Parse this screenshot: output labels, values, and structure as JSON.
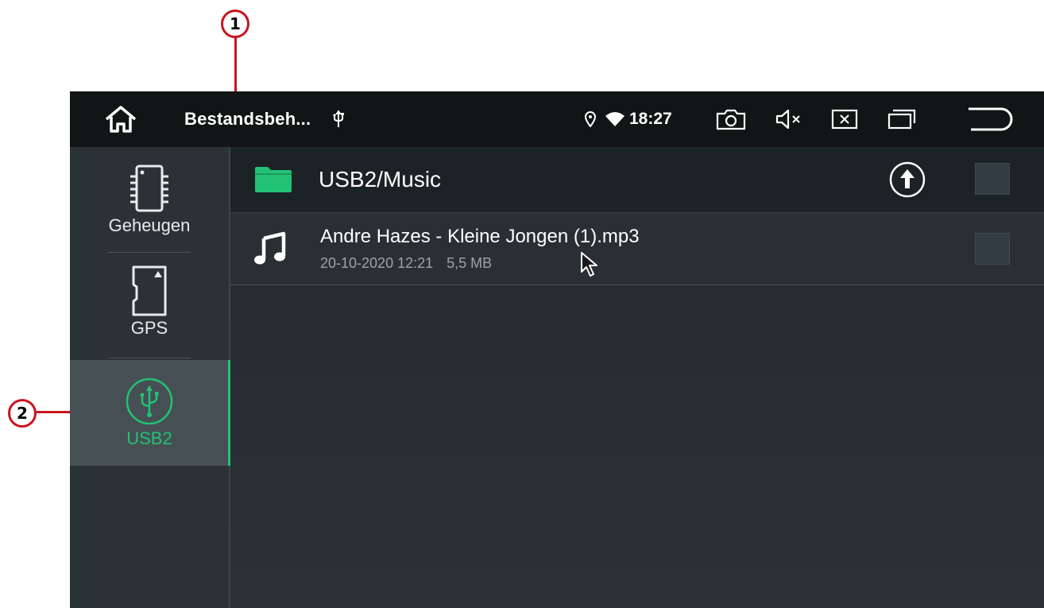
{
  "annotations": {
    "callout1": "1",
    "callout2": "2"
  },
  "statusbar": {
    "title": "Bestandsbeh...",
    "time": "18:27",
    "icons": [
      "home-icon",
      "usb-icon",
      "location-icon",
      "wifi-icon",
      "screenshot-icon",
      "mute-icon",
      "close-app-icon",
      "multitask-icon",
      "back-icon"
    ]
  },
  "sidebar": {
    "items": [
      {
        "label": "Geheugen",
        "icon": "memory-chip-icon",
        "active": false
      },
      {
        "label": "GPS",
        "icon": "sd-card-icon",
        "active": false
      },
      {
        "label": "USB2",
        "icon": "usb-icon",
        "active": true
      }
    ]
  },
  "main": {
    "path": "USB2/Music",
    "files": [
      {
        "name": "Andre Hazes - Kleine Jongen (1).mp3",
        "date": "20-10-2020 12:21",
        "size": "5,5 MB",
        "icon": "music-note-icon"
      }
    ]
  },
  "colors": {
    "accent": "#22c274",
    "statusbar": "#121516",
    "annotation": "#c8141e"
  }
}
